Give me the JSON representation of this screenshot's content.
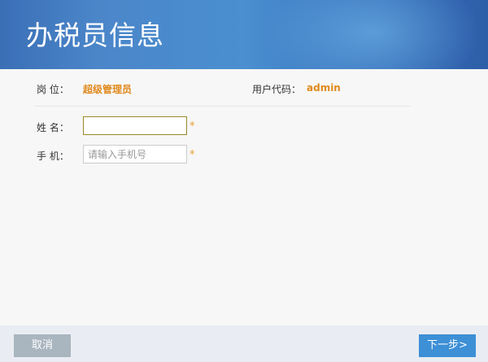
{
  "header": {
    "title": "办税员信息"
  },
  "info": {
    "position_label": "岗 位：",
    "position_value": "超级管理员",
    "user_code_label": "用户代码：",
    "user_code_value": "admin"
  },
  "form": {
    "name_label": "姓 名：",
    "name_value": "",
    "phone_label": "手 机：",
    "phone_value": "",
    "phone_placeholder": "请输入手机号",
    "required_mark": "*"
  },
  "footer": {
    "cancel_label": "取消",
    "next_label": "下一步>"
  },
  "colors": {
    "header_blue": "#3a74bd",
    "accent_orange": "#e08a1e",
    "next_button": "#3d8fd6",
    "cancel_button": "#a9b5bf"
  }
}
